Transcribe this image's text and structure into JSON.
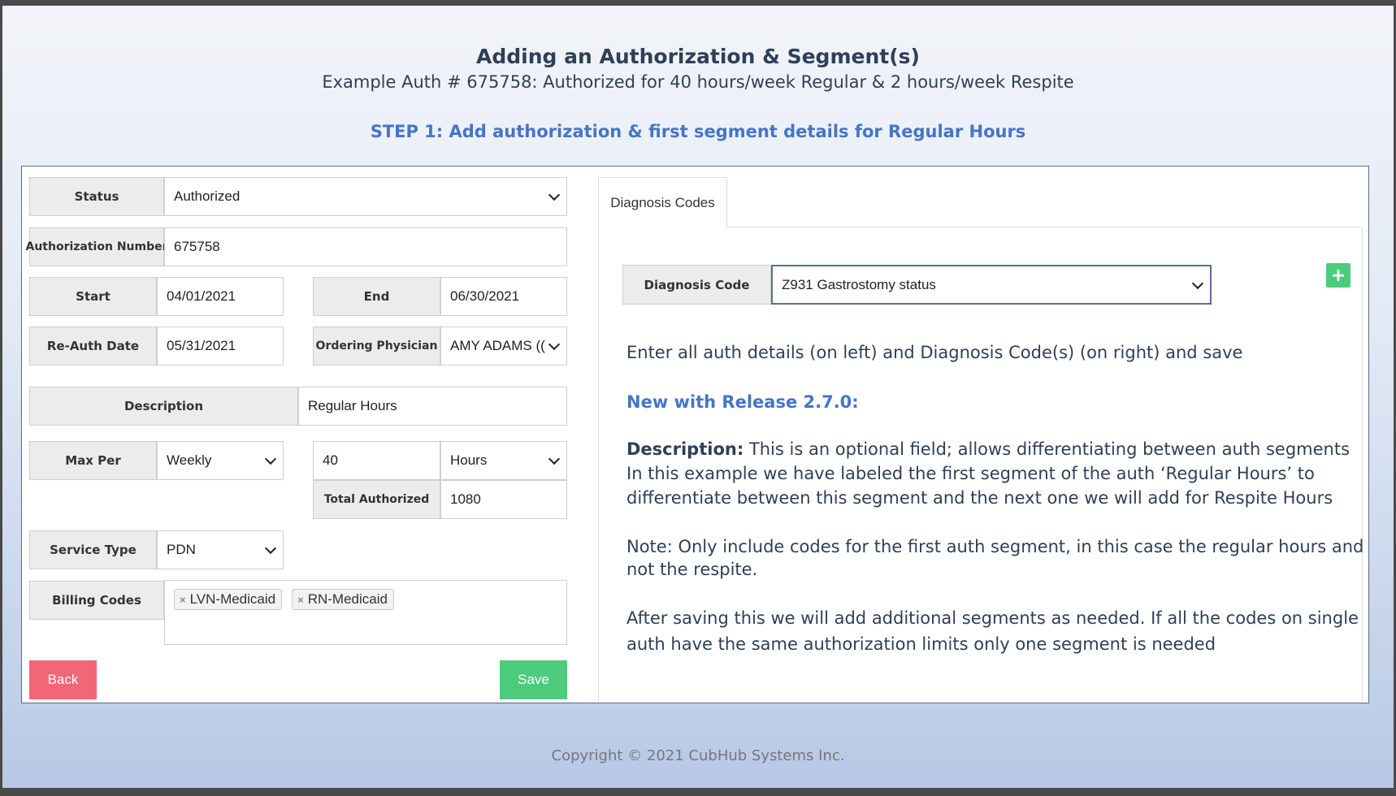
{
  "header": {
    "title": "Adding an Authorization & Segment(s)",
    "subtitle": "Example Auth # 675758: Authorized for 40 hours/week Regular & 2 hours/week Respite",
    "step": "STEP 1: Add authorization & first segment details for Regular Hours"
  },
  "form": {
    "status": {
      "label": "Status",
      "value": "Authorized"
    },
    "auth_number": {
      "label": "Authorization Number",
      "value": "675758"
    },
    "start": {
      "label": "Start",
      "value": "04/01/2021"
    },
    "end": {
      "label": "End",
      "value": "06/30/2021"
    },
    "reauth": {
      "label": "Re-Auth Date",
      "value": "05/31/2021"
    },
    "physician": {
      "label": "Ordering Physician",
      "value": "AMY ADAMS (("
    },
    "description": {
      "label": "Description",
      "value": "Regular Hours"
    },
    "max_per": {
      "label": "Max Per",
      "value": "Weekly"
    },
    "max_amount": {
      "value": "40"
    },
    "max_unit": {
      "value": "Hours"
    },
    "total": {
      "label": "Total Authorized",
      "value": "1080"
    },
    "service_type": {
      "label": "Service Type",
      "value": "PDN"
    },
    "billing": {
      "label": "Billing Codes",
      "codes": [
        "LVN-Medicaid",
        "RN-Medicaid"
      ],
      "remove_symbol": "×"
    },
    "back_label": "Back",
    "save_label": "Save"
  },
  "diagnosis": {
    "tab_label": "Diagnosis Codes",
    "code_label": "Diagnosis Code",
    "code_value": "Z931 Gastrostomy status",
    "add_symbol": "+"
  },
  "notes": {
    "line1": "Enter all auth details (on left) and Diagnosis Code(s) (on right) and save",
    "release": "New with Release 2.7.0:",
    "desc_bold": "Description:",
    "desc_rest": " This is an optional field; allows differentiating between auth segments",
    "desc_line2": "In this example we have labeled the first segment of the auth ‘Regular Hours’ to",
    "desc_line3": "differentiate between this segment and the next one we will add for Respite Hours",
    "note_line1": "Note: Only include codes for the first auth segment, in this case the regular hours and",
    "note_line2": "not the respite.",
    "after_line1": "After saving this we will add additional segments as needed. If all the codes on single",
    "after_line2": "auth have the same authorization limits only one segment is needed"
  },
  "footer": {
    "copyright": "Copyright © 2021 CubHub Systems Inc."
  },
  "colors": {
    "back": "#f26677",
    "save": "#4ccb7d",
    "accent": "#4575c5",
    "title": "#2f3f58"
  }
}
